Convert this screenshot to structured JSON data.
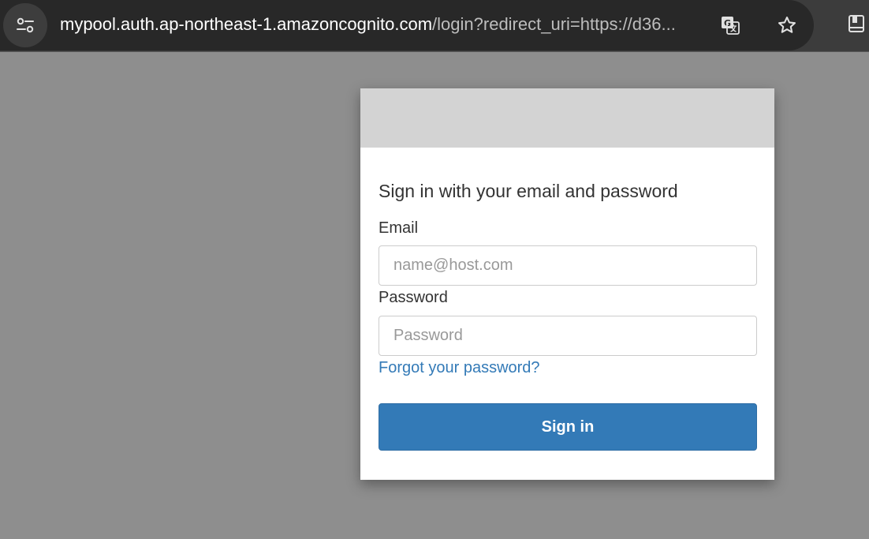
{
  "browser": {
    "url_host": "mypool.auth.ap-northeast-1.amazoncognito.com",
    "url_path": "/login?redirect_uri=https://d36...",
    "icons": {
      "site_info": "tune-icon",
      "translate": "translate-icon",
      "bookmark": "star-icon",
      "reading_list": "reading-list-icon"
    },
    "colors": {
      "toolbar": "#3c3c3c",
      "omnibox": "#282828",
      "url_host_text": "#ffffff",
      "url_path_text": "#bdbdbd"
    }
  },
  "page": {
    "background": "#8e8e8e"
  },
  "login": {
    "title": "Sign in with your email and password",
    "email_label": "Email",
    "email_value": "",
    "email_placeholder": "name@host.com",
    "password_label": "Password",
    "password_value": "",
    "password_placeholder": "Password",
    "forgot_link": "Forgot your password?",
    "signin_label": "Sign in",
    "colors": {
      "banner": "#d3d3d3",
      "primary": "#337ab7",
      "text": "#333333"
    }
  }
}
